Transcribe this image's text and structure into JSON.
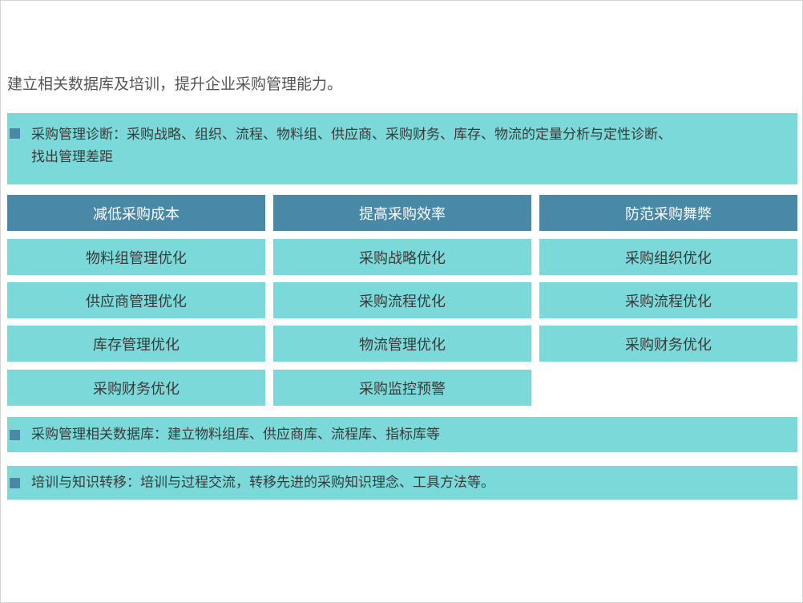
{
  "headline": "建立相关数据库及培训，提升企业采购管理能力。",
  "diagnosis": {
    "line1": "采购管理诊断：采购战略、组织、流程、物料组、供应商、采购财务、库存、物流的定量分析与定性诊断、",
    "line2": "找出管理差距"
  },
  "columns": [
    {
      "header": "减低采购成本",
      "items": [
        "物料组管理优化",
        "供应商管理优化",
        "库存管理优化",
        "采购财务优化"
      ]
    },
    {
      "header": "提高采购效率",
      "items": [
        "采购战略优化",
        "采购流程优化",
        "物流管理优化",
        "采购监控预警"
      ]
    },
    {
      "header": "防范采购舞弊",
      "items": [
        "采购组织优化",
        "采购流程优化",
        "采购财务优化"
      ]
    }
  ],
  "database": "采购管理相关数据库：建立物料组库、供应商库、流程库、指标库等",
  "training": "培训与知识转移：培训与过程交流，转移先进的采购知识理念、工具方法等。",
  "colors": {
    "band": "#7bd9d9",
    "header": "#4a88a8",
    "marker": "#4a88a8"
  }
}
